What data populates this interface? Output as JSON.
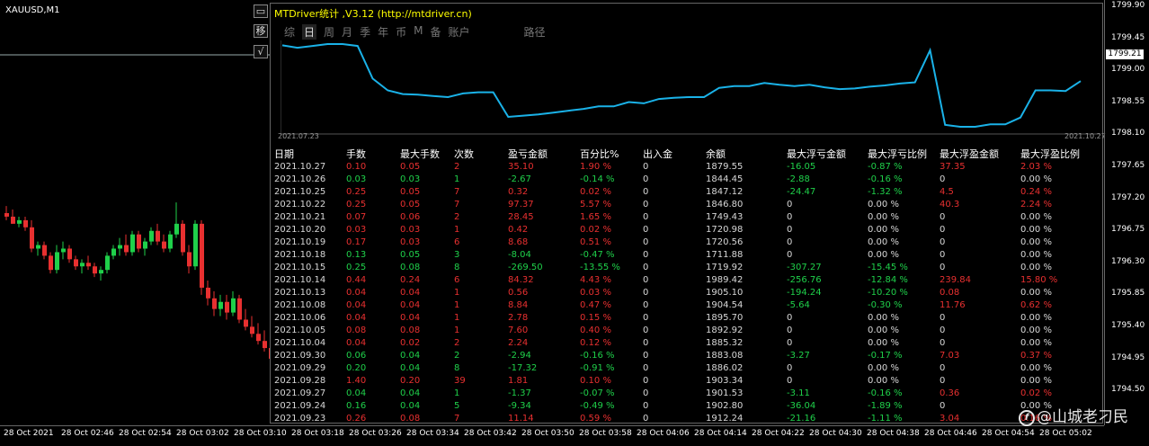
{
  "symbol": "XAUUSD,M1",
  "panel": {
    "title": "MTDriver统计 ,V3.12 (http://mtdriver.cn)",
    "minimize_label": "▭",
    "move_label": "移",
    "check_label": "√",
    "tabs": [
      "综",
      "日",
      "周",
      "月",
      "季",
      "年",
      "币",
      "M",
      "备",
      "账户",
      "路径"
    ],
    "active_tab": "日",
    "mini_chart": {
      "start_date": "2021.07.23",
      "end_date": "2021.10.27",
      "values": [
        1844,
        1840,
        1843,
        1846,
        1846,
        1843,
        1790,
        1771,
        1765,
        1764,
        1762,
        1760,
        1766,
        1768,
        1768,
        1728,
        1730,
        1732,
        1735,
        1738,
        1741,
        1745,
        1745,
        1752,
        1750,
        1757,
        1759,
        1760,
        1760,
        1775,
        1778,
        1778,
        1783,
        1780,
        1778,
        1780,
        1776,
        1773,
        1774,
        1777,
        1779,
        1782,
        1784,
        1836,
        1715,
        1712,
        1712,
        1716,
        1716,
        1727,
        1771,
        1771,
        1770,
        1786
      ]
    },
    "headers": [
      "日期",
      "手数",
      "最大手数",
      "次数",
      "盈亏金额",
      "百分比%",
      "出入金",
      "余额",
      "最大浮亏金额",
      "最大浮亏比例",
      "最大浮盈金额",
      "最大浮盈比例"
    ],
    "rows": [
      {
        "tone": "r",
        "cells": [
          "2021.10.27",
          "0.10",
          "0.05",
          "2",
          "35.10",
          "1.90 %",
          "0",
          "1879.55",
          "-16.05",
          "-0.87 %",
          "37.35",
          "2.03 %"
        ]
      },
      {
        "tone": "g",
        "cells": [
          "2021.10.26",
          "0.03",
          "0.03",
          "1",
          "-2.67",
          "-0.14 %",
          "0",
          "1844.45",
          "-2.88",
          "-0.16 %",
          "0",
          "0.00 %"
        ]
      },
      {
        "tone": "r",
        "cells": [
          "2021.10.25",
          "0.25",
          "0.05",
          "7",
          "0.32",
          "0.02 %",
          "0",
          "1847.12",
          "-24.47",
          "-1.32 %",
          "4.5",
          "0.24 %"
        ]
      },
      {
        "tone": "r",
        "cells": [
          "2021.10.22",
          "0.25",
          "0.05",
          "7",
          "97.37",
          "5.57 %",
          "0",
          "1846.80",
          "0",
          "0.00 %",
          "40.3",
          "2.24 %"
        ]
      },
      {
        "tone": "r",
        "cells": [
          "2021.10.21",
          "0.07",
          "0.06",
          "2",
          "28.45",
          "1.65 %",
          "0",
          "1749.43",
          "0",
          "0.00 %",
          "0",
          "0.00 %"
        ]
      },
      {
        "tone": "r",
        "cells": [
          "2021.10.20",
          "0.03",
          "0.03",
          "1",
          "0.42",
          "0.02 %",
          "0",
          "1720.98",
          "0",
          "0.00 %",
          "0",
          "0.00 %"
        ]
      },
      {
        "tone": "r",
        "cells": [
          "2021.10.19",
          "0.17",
          "0.03",
          "6",
          "8.68",
          "0.51 %",
          "0",
          "1720.56",
          "0",
          "0.00 %",
          "0",
          "0.00 %"
        ]
      },
      {
        "tone": "g",
        "cells": [
          "2021.10.18",
          "0.13",
          "0.05",
          "3",
          "-8.04",
          "-0.47 %",
          "0",
          "1711.88",
          "0",
          "0.00 %",
          "0",
          "0.00 %"
        ]
      },
      {
        "tone": "g",
        "cells": [
          "2021.10.15",
          "0.25",
          "0.08",
          "8",
          "-269.50",
          "-13.55 %",
          "0",
          "1719.92",
          "-307.27",
          "-15.45 %",
          "0",
          "0.00 %"
        ]
      },
      {
        "tone": "r",
        "cells": [
          "2021.10.14",
          "0.44",
          "0.24",
          "6",
          "84.32",
          "4.43 %",
          "0",
          "1989.42",
          "-256.76",
          "-12.84 %",
          "239.84",
          "15.80 %"
        ]
      },
      {
        "tone": "r",
        "cells": [
          "2021.10.13",
          "0.04",
          "0.04",
          "1",
          "0.56",
          "0.03 %",
          "0",
          "1905.10",
          "-194.24",
          "-10.20 %",
          "0.08",
          "0.00 %"
        ]
      },
      {
        "tone": "r",
        "cells": [
          "2021.10.08",
          "0.04",
          "0.04",
          "1",
          "8.84",
          "0.47 %",
          "0",
          "1904.54",
          "-5.64",
          "-0.30 %",
          "11.76",
          "0.62 %"
        ]
      },
      {
        "tone": "r",
        "cells": [
          "2021.10.06",
          "0.04",
          "0.04",
          "1",
          "2.78",
          "0.15 %",
          "0",
          "1895.70",
          "0",
          "0.00 %",
          "0",
          "0.00 %"
        ]
      },
      {
        "tone": "r",
        "cells": [
          "2021.10.05",
          "0.08",
          "0.08",
          "1",
          "7.60",
          "0.40 %",
          "0",
          "1892.92",
          "0",
          "0.00 %",
          "0",
          "0.00 %"
        ]
      },
      {
        "tone": "r",
        "cells": [
          "2021.10.04",
          "0.04",
          "0.02",
          "2",
          "2.24",
          "0.12 %",
          "0",
          "1885.32",
          "0",
          "0.00 %",
          "0",
          "0.00 %"
        ]
      },
      {
        "tone": "g",
        "cells": [
          "2021.09.30",
          "0.06",
          "0.04",
          "2",
          "-2.94",
          "-0.16 %",
          "0",
          "1883.08",
          "-3.27",
          "-0.17 %",
          "7.03",
          "0.37 %"
        ]
      },
      {
        "tone": "g",
        "cells": [
          "2021.09.29",
          "0.20",
          "0.04",
          "8",
          "-17.32",
          "-0.91 %",
          "0",
          "1886.02",
          "0",
          "0.00 %",
          "0",
          "0.00 %"
        ]
      },
      {
        "tone": "r",
        "cells": [
          "2021.09.28",
          "1.40",
          "0.20",
          "39",
          "1.81",
          "0.10 %",
          "0",
          "1903.34",
          "0",
          "0.00 %",
          "0",
          "0.00 %"
        ]
      },
      {
        "tone": "g",
        "cells": [
          "2021.09.27",
          "0.04",
          "0.04",
          "1",
          "-1.37",
          "-0.07 %",
          "0",
          "1901.53",
          "-3.11",
          "-0.16 %",
          "0.36",
          "0.02 %"
        ]
      },
      {
        "tone": "g",
        "cells": [
          "2021.09.24",
          "0.16",
          "0.04",
          "5",
          "-9.34",
          "-0.49 %",
          "0",
          "1902.80",
          "-36.04",
          "-1.89 %",
          "0",
          "0.00 %"
        ]
      },
      {
        "tone": "r",
        "cells": [
          "2021.09.23",
          "0.26",
          "0.08",
          "7",
          "11.14",
          "0.59 %",
          "0",
          "1912.24",
          "-21.16",
          "-1.11 %",
          "3.04",
          "0.16 %"
        ]
      }
    ]
  },
  "price_axis": {
    "labels": [
      "1799.90",
      "1799.45",
      "1799.00",
      "1798.55",
      "1798.10",
      "1797.65",
      "1797.20",
      "1796.75",
      "1796.30",
      "1795.85",
      "1795.40",
      "1794.95",
      "1794.50"
    ],
    "current_price": "1799.21"
  },
  "time_axis": {
    "labels": [
      "28 Oct 2021",
      "28 Oct 02:46",
      "28 Oct 02:54",
      "28 Oct 03:02",
      "28 Oct 03:10",
      "28 Oct 03:18",
      "28 Oct 03:26",
      "28 Oct 03:34",
      "28 Oct 03:42",
      "28 Oct 03:50",
      "28 Oct 03:58",
      "28 Oct 04:06",
      "28 Oct 04:14",
      "28 Oct 04:22",
      "28 Oct 04:30",
      "28 Oct 04:38",
      "28 Oct 04:46",
      "28 Oct 04:54",
      "28 Oct 05:02"
    ]
  },
  "candles": {
    "up_color": "#1fd04a",
    "down_color": "#e83030",
    "price_min": 1794.2,
    "price_max": 1800.1,
    "values": [
      [
        1797.15,
        1797.25,
        1797.05,
        1797.1
      ],
      [
        1797.1,
        1797.2,
        1797.0,
        1797.0
      ],
      [
        1797.0,
        1797.1,
        1796.95,
        1797.05
      ],
      [
        1797.05,
        1797.1,
        1796.9,
        1796.95
      ],
      [
        1796.95,
        1797.05,
        1796.6,
        1796.65
      ],
      [
        1796.65,
        1796.75,
        1796.55,
        1796.7
      ],
      [
        1796.7,
        1796.75,
        1796.5,
        1796.55
      ],
      [
        1796.55,
        1796.6,
        1796.3,
        1796.35
      ],
      [
        1796.35,
        1796.7,
        1796.3,
        1796.6
      ],
      [
        1796.6,
        1796.75,
        1796.5,
        1796.65
      ],
      [
        1796.65,
        1796.7,
        1796.45,
        1796.5
      ],
      [
        1796.5,
        1796.55,
        1796.35,
        1796.4
      ],
      [
        1796.4,
        1796.5,
        1796.3,
        1796.45
      ],
      [
        1796.45,
        1796.55,
        1796.35,
        1796.4
      ],
      [
        1796.4,
        1796.45,
        1796.25,
        1796.3
      ],
      [
        1796.3,
        1796.4,
        1796.2,
        1796.35
      ],
      [
        1796.35,
        1796.6,
        1796.3,
        1796.55
      ],
      [
        1796.55,
        1796.7,
        1796.5,
        1796.65
      ],
      [
        1796.65,
        1796.8,
        1796.55,
        1796.7
      ],
      [
        1796.7,
        1796.85,
        1796.55,
        1796.6
      ],
      [
        1796.6,
        1796.9,
        1796.55,
        1796.85
      ],
      [
        1796.85,
        1796.9,
        1796.6,
        1796.65
      ],
      [
        1796.65,
        1796.8,
        1796.55,
        1796.75
      ],
      [
        1796.75,
        1796.95,
        1796.7,
        1796.9
      ],
      [
        1796.9,
        1797.0,
        1796.7,
        1796.75
      ],
      [
        1796.75,
        1796.85,
        1796.6,
        1796.65
      ],
      [
        1796.65,
        1796.9,
        1796.6,
        1796.85
      ],
      [
        1796.85,
        1797.3,
        1796.8,
        1797.0
      ],
      [
        1797.0,
        1797.05,
        1796.55,
        1796.6
      ],
      [
        1796.6,
        1796.7,
        1796.3,
        1796.4
      ],
      [
        1796.4,
        1797.05,
        1796.35,
        1797.0
      ],
      [
        1797.0,
        1797.05,
        1796.0,
        1796.1
      ],
      [
        1796.1,
        1796.2,
        1795.85,
        1795.95
      ],
      [
        1795.95,
        1796.05,
        1795.7,
        1795.8
      ],
      [
        1795.8,
        1796.0,
        1795.7,
        1795.9
      ],
      [
        1795.9,
        1796.0,
        1795.65,
        1795.75
      ],
      [
        1795.75,
        1796.05,
        1795.7,
        1795.95
      ],
      [
        1795.95,
        1796.0,
        1795.6,
        1795.65
      ],
      [
        1795.65,
        1795.8,
        1795.5,
        1795.55
      ],
      [
        1795.55,
        1795.7,
        1795.4,
        1795.45
      ],
      [
        1795.45,
        1795.6,
        1795.3,
        1795.35
      ],
      [
        1795.35,
        1795.5,
        1795.2,
        1795.25
      ],
      [
        1795.25,
        1795.4,
        1795.0,
        1795.1
      ]
    ]
  },
  "watermark": {
    "logo": "f",
    "text": "@山城老刁民"
  }
}
